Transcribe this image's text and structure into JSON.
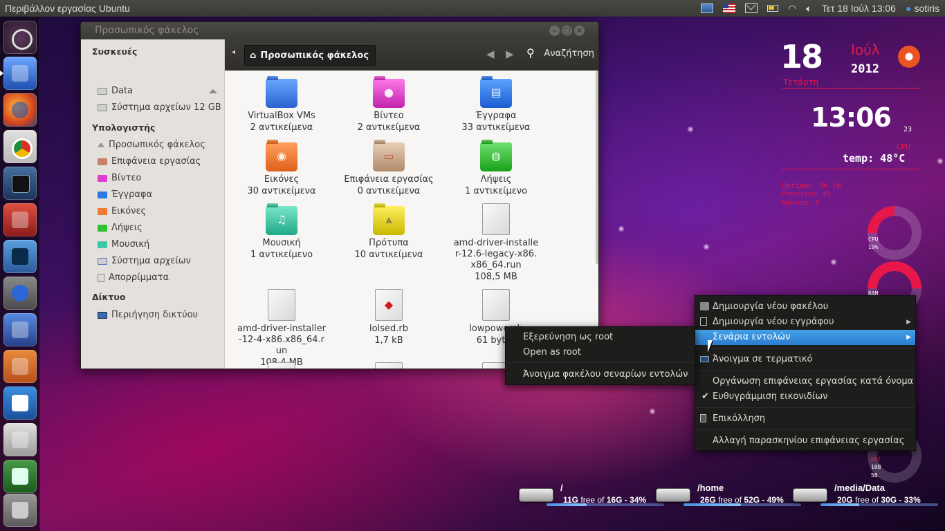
{
  "top_panel": {
    "title": "Περιβάλλον εργασίας Ubuntu",
    "datetime": "Τετ 18 Ιούλ 13:06",
    "user": "sotiris",
    "icons": [
      "image-viewer-icon",
      "us-flag-icon",
      "mail-icon",
      "battery-icon",
      "wifi-icon",
      "volume-icon",
      "user-icon"
    ]
  },
  "launcher": {
    "items": [
      {
        "name": "dash-home",
        "icon": "ubuntu-bfb-icon"
      },
      {
        "name": "home-folder",
        "icon": "folder-icon",
        "running": true
      },
      {
        "name": "firefox",
        "icon": "firefox-icon"
      },
      {
        "name": "chrome",
        "icon": "chrome-icon"
      },
      {
        "name": "terminal",
        "icon": "terminal-icon"
      },
      {
        "name": "update-manager",
        "icon": "update-icon"
      },
      {
        "name": "system-monitor",
        "icon": "monitor-icon"
      },
      {
        "name": "system-settings",
        "icon": "settings-icon"
      },
      {
        "name": "installer",
        "icon": "install-icon"
      },
      {
        "name": "software-center",
        "icon": "shopping-bag-icon"
      },
      {
        "name": "writer",
        "icon": "writer-icon"
      },
      {
        "name": "pen-editor",
        "icon": "pen-icon"
      },
      {
        "name": "calc",
        "icon": "spreadsheet-icon"
      },
      {
        "name": "trash",
        "icon": "trash-icon"
      }
    ]
  },
  "window": {
    "title": "Προσωπικός φάκελος",
    "location": "Προσωπικός φάκελος",
    "search_label": "Αναζήτηση",
    "sidebar": {
      "devices_heading": "Συσκευές",
      "devices": [
        {
          "label": "Data",
          "icon": "drive-icon"
        },
        {
          "label": "Σύστημα αρχείων 12 GB",
          "icon": "drive-icon"
        }
      ],
      "computer_heading": "Υπολογιστής",
      "places": [
        {
          "label": "Προσωπικός φάκελος",
          "icon": "home-icon"
        },
        {
          "label": "Επιφάνεια εργασίας",
          "icon": "desktop-folder-icon"
        },
        {
          "label": "Βίντεο",
          "icon": "video-folder-icon"
        },
        {
          "label": "Έγγραφα",
          "icon": "documents-folder-icon"
        },
        {
          "label": "Εικόνες",
          "icon": "pictures-folder-icon"
        },
        {
          "label": "Λήψεις",
          "icon": "downloads-folder-icon"
        },
        {
          "label": "Μουσική",
          "icon": "music-folder-icon"
        },
        {
          "label": "Σύστημα αρχείων",
          "icon": "filesystem-icon"
        },
        {
          "label": "Απορρίμματα",
          "icon": "trash-icon"
        }
      ],
      "network_heading": "Δίκτυο",
      "network": [
        {
          "label": "Περιήγηση δικτύου",
          "icon": "network-icon"
        }
      ]
    },
    "files": [
      {
        "name": "VirtualBox VMs",
        "meta": "2 αντικείμενα",
        "type": "folder",
        "color": "#3b82e8"
      },
      {
        "name": "Βίντεο",
        "meta": "2 αντικείμενα",
        "type": "folder",
        "color": "#e040d0"
      },
      {
        "name": "Έγγραφα",
        "meta": "33 αντικείμενα",
        "type": "folder",
        "color": "#2a78e4"
      },
      {
        "name": "Εικόνες",
        "meta": "30 αντικείμενα",
        "type": "folder",
        "color": "#f07a30"
      },
      {
        "name": "Επιφάνεια εργασίας",
        "meta": "0 αντικείμενα",
        "type": "folder",
        "color": "#c9a98a"
      },
      {
        "name": "Λήψεις",
        "meta": "1 αντικείμενο",
        "type": "folder",
        "color": "#2ec02e"
      },
      {
        "name": "Μουσική",
        "meta": "1 αντικείμενο",
        "type": "folder",
        "color": "#3cc8a8"
      },
      {
        "name": "Πρότυπα",
        "meta": "10 αντικείμενα",
        "type": "folder",
        "color": "#e4d41a"
      },
      {
        "name": "amd-driver-installer-12.6-legacy-x86.x86_64.run",
        "meta": "108,5 MB",
        "type": "file"
      },
      {
        "name": "amd-driver-installer-12-4-x86.x86_64.run",
        "meta": "108,4 MB",
        "type": "file"
      },
      {
        "name": "lolsed.rb",
        "meta": "1,7 kB",
        "type": "ruby"
      },
      {
        "name": "lowpowersh",
        "meta": "61 bytes",
        "type": "file"
      }
    ]
  },
  "desktop_menu": {
    "items": [
      {
        "label": "Δημιουργία νέου φακέλου",
        "icon": "new-folder-icon"
      },
      {
        "label": "Δημιουργία νέου εγγράφου",
        "icon": "new-document-icon",
        "submenu": true
      },
      {
        "label": "Σενάρια εντολών",
        "submenu": true,
        "active": true
      },
      {
        "label": "Άνοιγμα σε τερματικό",
        "icon": "terminal-icon"
      },
      {
        "label": "Οργάνωση επιφάνειας εργασίας κατά όνομα"
      },
      {
        "label": "Ευθυγράμμιση εικονιδίων",
        "checked": true
      },
      {
        "label": "Επικόλληση",
        "icon": "paste-icon"
      },
      {
        "label": "Αλλαγή παρασκηνίου επιφάνειας εργασίας"
      }
    ]
  },
  "scripts_submenu": {
    "items": [
      {
        "label": "Εξερεύνηση ως root"
      },
      {
        "label": "Open as root"
      },
      {
        "label": "Άνοιγμα φακέλου σεναρίων εντολών"
      }
    ]
  },
  "conky": {
    "day": "18",
    "month": "Ιούλ",
    "year": "2012",
    "weekday": "Τετάρτη",
    "time": "13:06",
    "seconds": "23",
    "cpu_label": "CPU",
    "temp": "temp: 48°C",
    "uptime": "Uptime: 3h 7m",
    "processes": "Processes: 65",
    "running": "Running: 0",
    "gauges": [
      {
        "label": "CPU",
        "value_text": "19%",
        "fraction": 0.19
      },
      {
        "label": "RAM",
        "value_text": "",
        "fraction": 0.35
      }
    ],
    "net_label": "NET",
    "net_values": [
      "10B",
      "5B"
    ],
    "accent": "#e8174a"
  },
  "drives": [
    {
      "mount": "/",
      "free": "11G",
      "total": "16G",
      "pct": "34%",
      "fraction": 0.34
    },
    {
      "mount": "/home",
      "free": "26G",
      "total": "52G",
      "pct": "49%",
      "fraction": 0.49
    },
    {
      "mount": "/media/Data",
      "free": "20G",
      "total": "30G",
      "pct": "33%",
      "fraction": 0.33
    }
  ],
  "drive_text": {
    "free_of": "free of",
    "sep": " - "
  }
}
